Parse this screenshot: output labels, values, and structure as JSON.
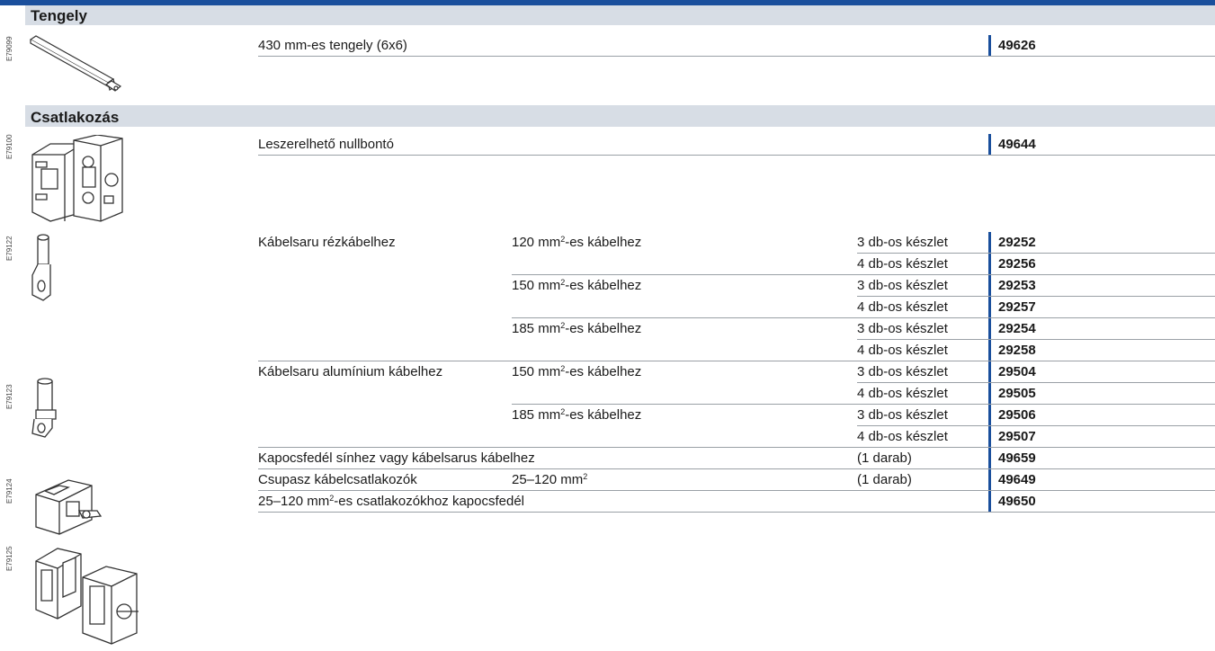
{
  "sections": {
    "tengely": "Tengely",
    "csatlakozas": "Csatlakozás"
  },
  "image_ids": [
    "E79099",
    "E79100",
    "E79122",
    "E79123",
    "E79124",
    "E79125"
  ],
  "rows": {
    "r1": {
      "desc": "430 mm-es tengely (6x6)",
      "code": "49626"
    },
    "r2": {
      "desc": "Leszerelhető nullbontó",
      "code": "49644"
    },
    "r3": {
      "desc": "Kábelsaru rézkábelhez",
      "size": "120 mm²-es kábelhez",
      "pack": "3 db-os készlet",
      "code": "29252"
    },
    "r4": {
      "pack": "4 db-os készlet",
      "code": "29256"
    },
    "r5": {
      "size": "150 mm²-es kábelhez",
      "pack": "3 db-os készlet",
      "code": "29253"
    },
    "r6": {
      "pack": "4 db-os készlet",
      "code": "29257"
    },
    "r7": {
      "size": "185 mm²-es kábelhez",
      "pack": "3 db-os készlet",
      "code": "29254"
    },
    "r8": {
      "pack": "4 db-os készlet",
      "code": "29258"
    },
    "r9": {
      "desc": "Kábelsaru alumínium kábelhez",
      "size": "150 mm²-es kábelhez",
      "pack": "3 db-os készlet",
      "code": "29504"
    },
    "r10": {
      "pack": "4 db-os készlet",
      "code": "29505"
    },
    "r11": {
      "size": "185 mm²-es kábelhez",
      "pack": "3 db-os készlet",
      "code": "29506"
    },
    "r12": {
      "pack": "4 db-os készlet",
      "code": "29507"
    },
    "r13": {
      "desc": "Kapocsfedél sínhez vagy kábelsarus kábelhez",
      "pack": "(1 darab)",
      "code": "49659"
    },
    "r14": {
      "desc": "Csupasz kábelcsatlakozók",
      "size": "25–120 mm²",
      "pack": "(1 darab)",
      "code": "49649"
    },
    "r15": {
      "desc": "25–120 mm²-es csatlakozókhoz kapocsfedél",
      "code": "49650"
    }
  },
  "colors": {
    "accent": "#1a4f9c",
    "section_bg": "#d7dde5"
  },
  "icons": [
    "shaft-icon",
    "neutral-disconnector-icon",
    "copper-lug-icon",
    "aluminium-lug-icon",
    "terminal-cover-icon",
    "bare-cable-connector-icon"
  ]
}
